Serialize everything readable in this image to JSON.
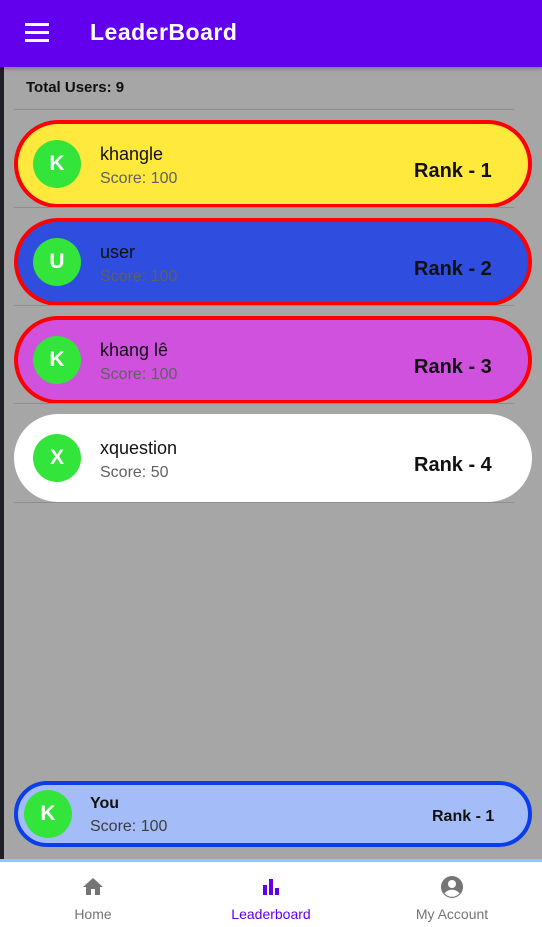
{
  "appbar": {
    "title": "LeaderBoard"
  },
  "summary": {
    "total_users": "Total Users: 9"
  },
  "leaderboard": [
    {
      "initial": "K",
      "name": "khangle",
      "score": "Score: 100",
      "rank": "Rank - 1",
      "bg_color": "#ffe93d",
      "highlighted": true
    },
    {
      "initial": "U",
      "name": "user",
      "score": "Score: 100",
      "rank": "Rank - 2",
      "bg_color": "#2f4ddf",
      "highlighted": true
    },
    {
      "initial": "K",
      "name": "khang lê",
      "score": "Score: 100",
      "rank": "Rank - 3",
      "bg_color": "#d151df",
      "highlighted": true
    },
    {
      "initial": "X",
      "name": "xquestion",
      "score": "Score: 50",
      "rank": "Rank - 4",
      "bg_color": "#ffffff",
      "highlighted": false
    }
  ],
  "current_user": {
    "initial": "K",
    "name": "You",
    "score": "Score: 100",
    "rank": "Rank - 1",
    "bg_color": "#a4bcf8",
    "border_color": "#0b3ee8"
  },
  "bottom_nav": {
    "items": [
      {
        "label": "Home",
        "icon": "home-icon",
        "active": false
      },
      {
        "label": "Leaderboard",
        "icon": "bar-chart-icon",
        "active": true
      },
      {
        "label": "My Account",
        "icon": "account-circle-icon",
        "active": false
      }
    ]
  },
  "colors": {
    "primary": "#6200ee",
    "background": "#a6a6a6",
    "avatar": "#33e43a",
    "highlight_border": "#ff0000",
    "nav_inactive": "#757575"
  }
}
